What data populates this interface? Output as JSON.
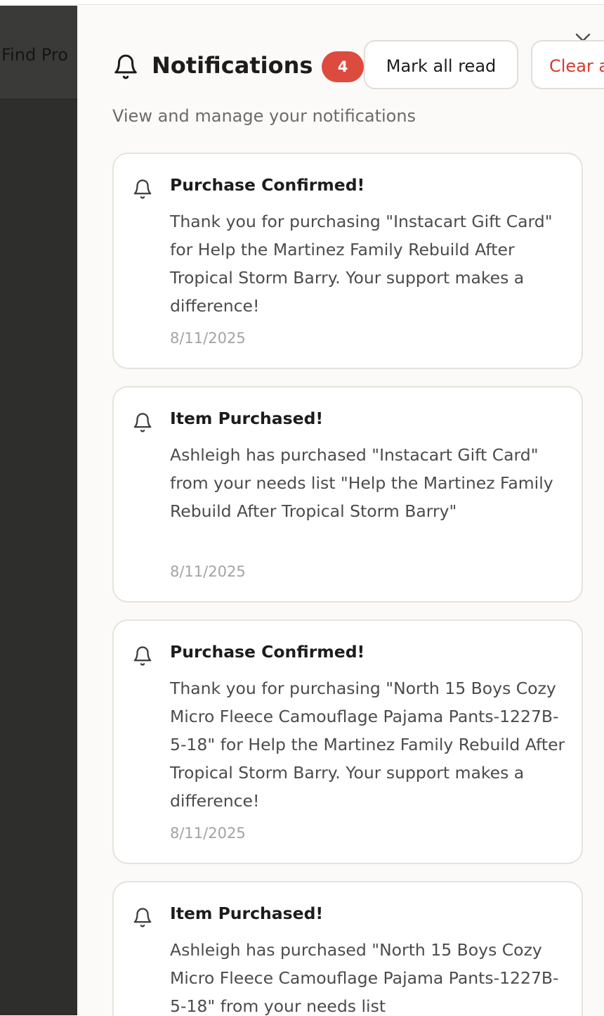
{
  "background": {
    "header_text": "Find Pro"
  },
  "panel": {
    "title": "Notifications",
    "unread_count": "4",
    "mark_all_read_label": "Mark all read",
    "clear_label": "Clear all",
    "subtitle": "View and manage your notifications",
    "close_icon": "close-icon"
  },
  "notifications": [
    {
      "title": "Purchase Confirmed!",
      "message": "Thank you for purchasing \"Instacart Gift Card\" for Help the Martinez Family Rebuild After Tropical Storm Barry. Your support makes a difference!",
      "date": "8/11/2025"
    },
    {
      "title": "Item Purchased!",
      "message": "Ashleigh has purchased \"Instacart Gift Card\" from your needs list \"Help the Martinez Family Rebuild After Tropical Storm Barry\"",
      "date": "8/11/2025"
    },
    {
      "title": "Purchase Confirmed!",
      "message": "Thank you for purchasing \"North 15 Boys Cozy Micro Fleece Camouflage Pajama Pants-1227B-5-18\" for Help the Martinez Family Rebuild After Tropical Storm Barry. Your support makes a difference!",
      "date": "8/11/2025"
    },
    {
      "title": "Item Purchased!",
      "message": "Ashleigh has purchased \"North 15 Boys Cozy Micro Fleece Camouflage Pajama Pants-1227B-5-18\" from your needs list",
      "date": ""
    }
  ],
  "colors": {
    "badge": "#dd4b3e",
    "clear_text": "#d63a2f",
    "panel_bg": "#fcfaf8",
    "backdrop": "#2e2e2d"
  }
}
